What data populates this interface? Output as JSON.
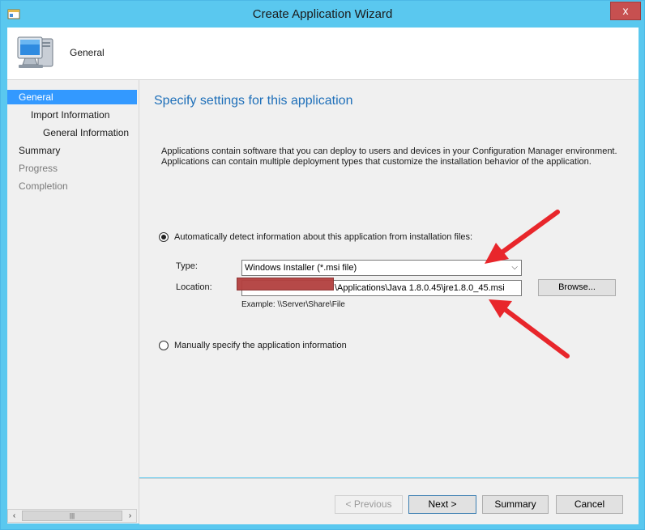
{
  "window": {
    "title": "Create Application Wizard",
    "close_label": "x"
  },
  "header": {
    "title": "General"
  },
  "nav": {
    "items": [
      {
        "label": "General",
        "state": "active"
      },
      {
        "label": "Import Information",
        "state": "normal"
      },
      {
        "label": "General Information",
        "state": "normal"
      },
      {
        "label": "Summary",
        "state": "normal"
      },
      {
        "label": "Progress",
        "state": "disabled"
      },
      {
        "label": "Completion",
        "state": "disabled"
      }
    ]
  },
  "content": {
    "heading": "Specify settings for this application",
    "description_line1": "Applications contain software that you can deploy to users and devices in your Configuration Manager environment.",
    "description_line2": "Applications can contain multiple deployment types that customize the installation behavior of the application.",
    "auto_detect_label": "Automatically detect information about this application from installation files:",
    "type_label": "Type:",
    "type_value": "Windows Installer (*.msi file)",
    "location_label": "Location:",
    "location_value": "\\Applications\\Java 1.8.0.45\\jre1.8.0_45.msi",
    "browse_label": "Browse...",
    "example_text": "Example: \\\\Server\\Share\\File",
    "manual_label": "Manually specify the application information"
  },
  "footer": {
    "previous_label": "< Previous",
    "next_label": "Next >",
    "summary_label": "Summary",
    "cancel_label": "Cancel"
  },
  "colors": {
    "accent": "#3399ff",
    "titlebar": "#5ac8ef",
    "heading": "#1e6fb9",
    "annotation_arrow": "#e8262b",
    "close": "#c75050"
  }
}
